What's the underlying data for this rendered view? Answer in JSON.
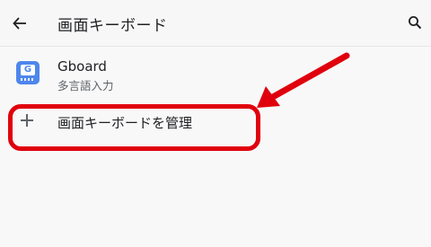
{
  "appbar": {
    "title": "画面キーボード",
    "back_icon": "arrow-left-icon",
    "search_icon": "search-icon"
  },
  "keyboards": [
    {
      "name": "Gboard",
      "subtitle": "多言語入力",
      "icon": "gboard-icon",
      "icon_letter": "G"
    }
  ],
  "manage": {
    "label": "画面キーボードを管理",
    "icon": "plus-icon"
  },
  "annotation": {
    "color": "#e0000d"
  }
}
